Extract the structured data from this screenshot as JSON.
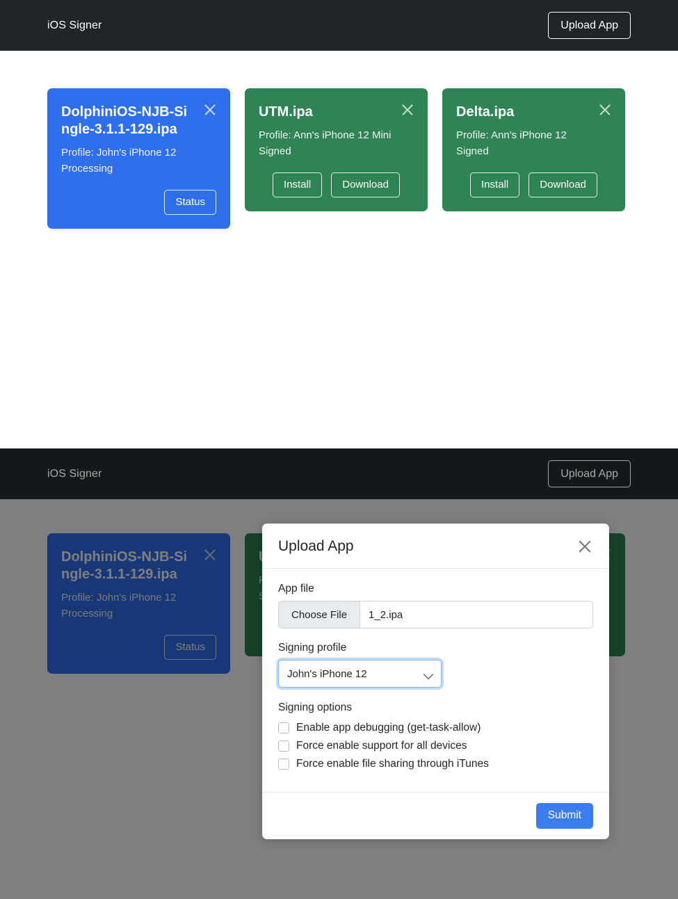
{
  "navbar": {
    "brand": "iOS Signer",
    "upload_button": "Upload App"
  },
  "cards": [
    {
      "title": "DolphiniOS-NJB-Single-3.1.1-129.ipa",
      "profile": "Profile: John's iPhone 12",
      "status": "Processing",
      "color": "#2f6fed",
      "state": "processing",
      "actions": [
        "Status"
      ],
      "close_icon": "close-icon"
    },
    {
      "title": "UTM.ipa",
      "profile": "Profile: Ann's iPhone 12 Mini",
      "status": "Signed",
      "color": "#2f8454",
      "state": "signed",
      "actions": [
        "Install",
        "Download"
      ],
      "close_icon": "close-icon"
    },
    {
      "title": "Delta.ipa",
      "profile": "Profile: Ann's iPhone 12",
      "status": "Signed",
      "color": "#2f8454",
      "state": "signed",
      "actions": [
        "Install",
        "Download"
      ],
      "close_icon": "close-icon"
    }
  ],
  "modal": {
    "title": "Upload App",
    "close_icon": "close-icon",
    "app_file_label": "App file",
    "choose_file_button": "Choose File",
    "file_name": "1_2.ipa",
    "signing_profile_label": "Signing profile",
    "signing_profile_value": "John's iPhone 12",
    "signing_profile_options": [
      "John's iPhone 12",
      "Ann's iPhone 12",
      "Ann's iPhone 12 Mini"
    ],
    "dropdown_icon": "chevron-down-icon",
    "signing_options_label": "Signing options",
    "signing_options": [
      {
        "label": "Enable app debugging (get-task-allow)",
        "checked": false
      },
      {
        "label": "Force enable support for all devices",
        "checked": false
      },
      {
        "label": "Force enable file sharing through iTunes",
        "checked": false
      }
    ],
    "submit_button": "Submit"
  },
  "colors": {
    "navbar": "#212529",
    "accent_blue": "#2f6fed",
    "accent_green": "#2f8454",
    "submit_blue": "#3b7ded",
    "overlay": "#808080",
    "focus_ring": "#86b7fe"
  }
}
